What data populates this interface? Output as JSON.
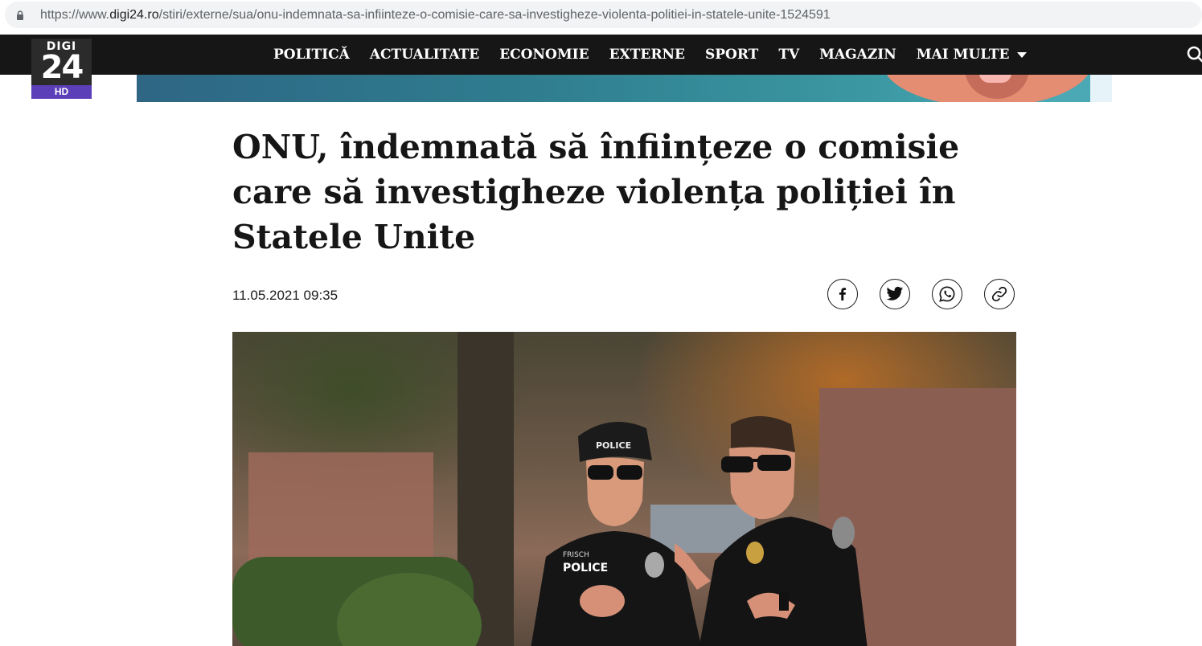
{
  "browser": {
    "url_prefix": "https://www.",
    "url_host": "digi24.ro",
    "url_path": "/stiri/externe/sua/onu-indemnata-sa-infiinteze-o-comisie-care-sa-investigheze-violenta-politiei-in-statele-unite-1524591"
  },
  "logo": {
    "top": "DIGI",
    "number": "24",
    "badge": "HD"
  },
  "nav": {
    "items": [
      "POLITICĂ",
      "ACTUALITATE",
      "ECONOMIE",
      "EXTERNE",
      "SPORT",
      "TV",
      "MAGAZIN",
      "MAI MULTE"
    ],
    "icons": [
      "search-icon"
    ]
  },
  "article": {
    "title": "ONU, îndemnată să înființeze o comisie care să investigheze violența poliției în Statele Unite",
    "date": "11.05.2021 09:35",
    "share": [
      "facebook-icon",
      "twitter-icon",
      "whatsapp-icon",
      "link-icon"
    ]
  },
  "hero": {
    "cap_text": "POLICE",
    "vest_name": "FRISCH",
    "vest_text": "POLICE"
  },
  "colors": {
    "nav_bg": "#161616",
    "logo_badge": "#5a3fb8",
    "title": "#161616"
  }
}
